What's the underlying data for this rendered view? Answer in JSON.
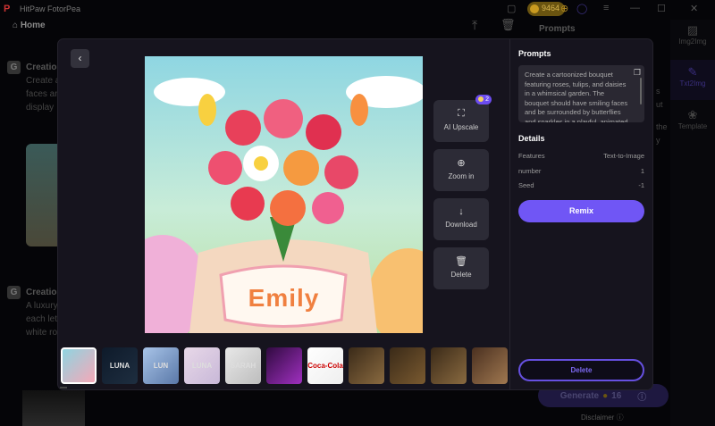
{
  "app": {
    "title": "HitPaw FotorPea",
    "coins": "9464",
    "home": "Home"
  },
  "background": {
    "creation1": {
      "title": "Creatio",
      "text": [
        "Create a",
        "faces an",
        "display"
      ]
    },
    "creation2": {
      "title": "Creatio",
      "text": [
        "A luxury",
        "each let",
        "white ro"
      ]
    },
    "panel_title": "Prompts",
    "side_text": [
      "s",
      "ut",
      "the",
      "y"
    ],
    "rail": [
      {
        "label": "Img2Img",
        "icon": "image-icon"
      },
      {
        "label": "Txt2Img",
        "icon": "edit-image-icon",
        "active": true
      },
      {
        "label": "Template",
        "icon": "template-icon"
      }
    ],
    "generate": {
      "label": "Generate",
      "cost": "16"
    },
    "disclaimer": "Disclaimer"
  },
  "modal": {
    "image_text": "Emily",
    "actions": [
      {
        "label": "AI Upscale",
        "icon": "upscale-icon",
        "badge": "2"
      },
      {
        "label": "Zoom in",
        "icon": "zoom-in-icon"
      },
      {
        "label": "Download",
        "icon": "download-icon"
      },
      {
        "label": "Delete",
        "icon": "trash-icon"
      }
    ],
    "thumbnails": [
      {
        "label": "",
        "colors": [
          "#8fd4e0",
          "#f5a8b8"
        ],
        "selected": true
      },
      {
        "label": "LUNA",
        "colors": [
          "#0e1a2a",
          "#1e2e40"
        ]
      },
      {
        "label": "LUN",
        "colors": [
          "#a8c4e8",
          "#5a78a8"
        ]
      },
      {
        "label": "LUNA",
        "colors": [
          "#e8d8e8",
          "#c8b8d8"
        ]
      },
      {
        "label": "SARAH",
        "colors": [
          "#e8e8e8",
          "#bdbdbd"
        ]
      },
      {
        "label": "",
        "colors": [
          "#300a40",
          "#a030c0"
        ]
      },
      {
        "label": "Coca-Cola",
        "colors": [
          "#ffffff",
          "#eeeeee"
        ]
      },
      {
        "label": "",
        "colors": [
          "#3a2a18",
          "#8a6a40"
        ]
      },
      {
        "label": "",
        "colors": [
          "#3a2a18",
          "#7a5a30"
        ]
      },
      {
        "label": "",
        "colors": [
          "#3a2a18",
          "#8a6a40"
        ]
      },
      {
        "label": "",
        "colors": [
          "#4a3020",
          "#a07850"
        ]
      }
    ],
    "prompts_title": "Prompts",
    "prompt": "Create a cartoonized bouquet featuring roses, tulips, and daisies in a whimsical garden. The bouquet should have smiling faces and be surrounded by butterflies and sparkles in a playful, animated",
    "details_title": "Details",
    "details": [
      {
        "label": "Features",
        "value": "Text-to-Image"
      },
      {
        "label": "number",
        "value": "1"
      },
      {
        "label": "Seed",
        "value": "-1"
      }
    ],
    "remix": "Remix",
    "delete": "Delete"
  }
}
